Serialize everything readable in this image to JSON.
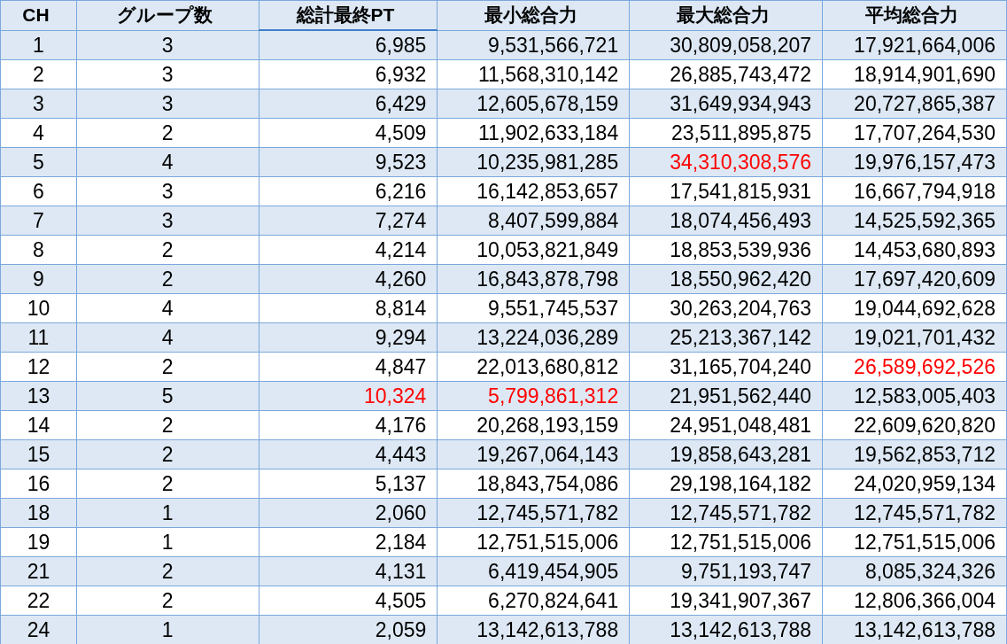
{
  "table": {
    "columns": [
      {
        "label": "CH",
        "selected": false
      },
      {
        "label": "グループ数",
        "selected": false
      },
      {
        "label": "総計最終PT",
        "selected": true
      },
      {
        "label": "最小総合力",
        "selected": false
      },
      {
        "label": "最大総合力",
        "selected": false
      },
      {
        "label": "平均総合力",
        "selected": false
      }
    ],
    "rows": [
      [
        {
          "text": "1",
          "highlighted": false
        },
        {
          "text": "3",
          "highlighted": false
        },
        {
          "text": "6,985",
          "highlighted": false
        },
        {
          "text": "9,531,566,721",
          "highlighted": false
        },
        {
          "text": "30,809,058,207",
          "highlighted": false
        },
        {
          "text": "17,921,664,006",
          "highlighted": false
        }
      ],
      [
        {
          "text": "2",
          "highlighted": false
        },
        {
          "text": "3",
          "highlighted": false
        },
        {
          "text": "6,932",
          "highlighted": false
        },
        {
          "text": "11,568,310,142",
          "highlighted": false
        },
        {
          "text": "26,885,743,472",
          "highlighted": false
        },
        {
          "text": "18,914,901,690",
          "highlighted": false
        }
      ],
      [
        {
          "text": "3",
          "highlighted": false
        },
        {
          "text": "3",
          "highlighted": false
        },
        {
          "text": "6,429",
          "highlighted": false
        },
        {
          "text": "12,605,678,159",
          "highlighted": false
        },
        {
          "text": "31,649,934,943",
          "highlighted": false
        },
        {
          "text": "20,727,865,387",
          "highlighted": false
        }
      ],
      [
        {
          "text": "4",
          "highlighted": false
        },
        {
          "text": "2",
          "highlighted": false
        },
        {
          "text": "4,509",
          "highlighted": false
        },
        {
          "text": "11,902,633,184",
          "highlighted": false
        },
        {
          "text": "23,511,895,875",
          "highlighted": false
        },
        {
          "text": "17,707,264,530",
          "highlighted": false
        }
      ],
      [
        {
          "text": "5",
          "highlighted": false
        },
        {
          "text": "4",
          "highlighted": false
        },
        {
          "text": "9,523",
          "highlighted": false
        },
        {
          "text": "10,235,981,285",
          "highlighted": false
        },
        {
          "text": "34,310,308,576",
          "highlighted": true
        },
        {
          "text": "19,976,157,473",
          "highlighted": false
        }
      ],
      [
        {
          "text": "6",
          "highlighted": false
        },
        {
          "text": "3",
          "highlighted": false
        },
        {
          "text": "6,216",
          "highlighted": false
        },
        {
          "text": "16,142,853,657",
          "highlighted": false
        },
        {
          "text": "17,541,815,931",
          "highlighted": false
        },
        {
          "text": "16,667,794,918",
          "highlighted": false
        }
      ],
      [
        {
          "text": "7",
          "highlighted": false
        },
        {
          "text": "3",
          "highlighted": false
        },
        {
          "text": "7,274",
          "highlighted": false
        },
        {
          "text": "8,407,599,884",
          "highlighted": false
        },
        {
          "text": "18,074,456,493",
          "highlighted": false
        },
        {
          "text": "14,525,592,365",
          "highlighted": false
        }
      ],
      [
        {
          "text": "8",
          "highlighted": false
        },
        {
          "text": "2",
          "highlighted": false
        },
        {
          "text": "4,214",
          "highlighted": false
        },
        {
          "text": "10,053,821,849",
          "highlighted": false
        },
        {
          "text": "18,853,539,936",
          "highlighted": false
        },
        {
          "text": "14,453,680,893",
          "highlighted": false
        }
      ],
      [
        {
          "text": "9",
          "highlighted": false
        },
        {
          "text": "2",
          "highlighted": false
        },
        {
          "text": "4,260",
          "highlighted": false
        },
        {
          "text": "16,843,878,798",
          "highlighted": false
        },
        {
          "text": "18,550,962,420",
          "highlighted": false
        },
        {
          "text": "17,697,420,609",
          "highlighted": false
        }
      ],
      [
        {
          "text": "10",
          "highlighted": false
        },
        {
          "text": "4",
          "highlighted": false
        },
        {
          "text": "8,814",
          "highlighted": false
        },
        {
          "text": "9,551,745,537",
          "highlighted": false
        },
        {
          "text": "30,263,204,763",
          "highlighted": false
        },
        {
          "text": "19,044,692,628",
          "highlighted": false
        }
      ],
      [
        {
          "text": "11",
          "highlighted": false
        },
        {
          "text": "4",
          "highlighted": false
        },
        {
          "text": "9,294",
          "highlighted": false
        },
        {
          "text": "13,224,036,289",
          "highlighted": false
        },
        {
          "text": "25,213,367,142",
          "highlighted": false
        },
        {
          "text": "19,021,701,432",
          "highlighted": false
        }
      ],
      [
        {
          "text": "12",
          "highlighted": false
        },
        {
          "text": "2",
          "highlighted": false
        },
        {
          "text": "4,847",
          "highlighted": false
        },
        {
          "text": "22,013,680,812",
          "highlighted": false
        },
        {
          "text": "31,165,704,240",
          "highlighted": false
        },
        {
          "text": "26,589,692,526",
          "highlighted": true
        }
      ],
      [
        {
          "text": "13",
          "highlighted": false
        },
        {
          "text": "5",
          "highlighted": false
        },
        {
          "text": "10,324",
          "highlighted": true
        },
        {
          "text": "5,799,861,312",
          "highlighted": true
        },
        {
          "text": "21,951,562,440",
          "highlighted": false
        },
        {
          "text": "12,583,005,403",
          "highlighted": false
        }
      ],
      [
        {
          "text": "14",
          "highlighted": false
        },
        {
          "text": "2",
          "highlighted": false
        },
        {
          "text": "4,176",
          "highlighted": false
        },
        {
          "text": "20,268,193,159",
          "highlighted": false
        },
        {
          "text": "24,951,048,481",
          "highlighted": false
        },
        {
          "text": "22,609,620,820",
          "highlighted": false
        }
      ],
      [
        {
          "text": "15",
          "highlighted": false
        },
        {
          "text": "2",
          "highlighted": false
        },
        {
          "text": "4,443",
          "highlighted": false
        },
        {
          "text": "19,267,064,143",
          "highlighted": false
        },
        {
          "text": "19,858,643,281",
          "highlighted": false
        },
        {
          "text": "19,562,853,712",
          "highlighted": false
        }
      ],
      [
        {
          "text": "16",
          "highlighted": false
        },
        {
          "text": "2",
          "highlighted": false
        },
        {
          "text": "5,137",
          "highlighted": false
        },
        {
          "text": "18,843,754,086",
          "highlighted": false
        },
        {
          "text": "29,198,164,182",
          "highlighted": false
        },
        {
          "text": "24,020,959,134",
          "highlighted": false
        }
      ],
      [
        {
          "text": "18",
          "highlighted": false
        },
        {
          "text": "1",
          "highlighted": false
        },
        {
          "text": "2,060",
          "highlighted": false
        },
        {
          "text": "12,745,571,782",
          "highlighted": false
        },
        {
          "text": "12,745,571,782",
          "highlighted": false
        },
        {
          "text": "12,745,571,782",
          "highlighted": false
        }
      ],
      [
        {
          "text": "19",
          "highlighted": false
        },
        {
          "text": "1",
          "highlighted": false
        },
        {
          "text": "2,184",
          "highlighted": false
        },
        {
          "text": "12,751,515,006",
          "highlighted": false
        },
        {
          "text": "12,751,515,006",
          "highlighted": false
        },
        {
          "text": "12,751,515,006",
          "highlighted": false
        }
      ],
      [
        {
          "text": "21",
          "highlighted": false
        },
        {
          "text": "2",
          "highlighted": false
        },
        {
          "text": "4,131",
          "highlighted": false
        },
        {
          "text": "6,419,454,905",
          "highlighted": false
        },
        {
          "text": "9,751,193,747",
          "highlighted": false
        },
        {
          "text": "8,085,324,326",
          "highlighted": false
        }
      ],
      [
        {
          "text": "22",
          "highlighted": false
        },
        {
          "text": "2",
          "highlighted": false
        },
        {
          "text": "4,505",
          "highlighted": false
        },
        {
          "text": "6,270,824,641",
          "highlighted": false
        },
        {
          "text": "19,341,907,367",
          "highlighted": false
        },
        {
          "text": "12,806,366,004",
          "highlighted": false
        }
      ],
      [
        {
          "text": "24",
          "highlighted": false
        },
        {
          "text": "1",
          "highlighted": false
        },
        {
          "text": "2,059",
          "highlighted": false
        },
        {
          "text": "13,142,613,788",
          "highlighted": false
        },
        {
          "text": "13,142,613,788",
          "highlighted": false
        },
        {
          "text": "13,142,613,788",
          "highlighted": false
        }
      ]
    ]
  }
}
